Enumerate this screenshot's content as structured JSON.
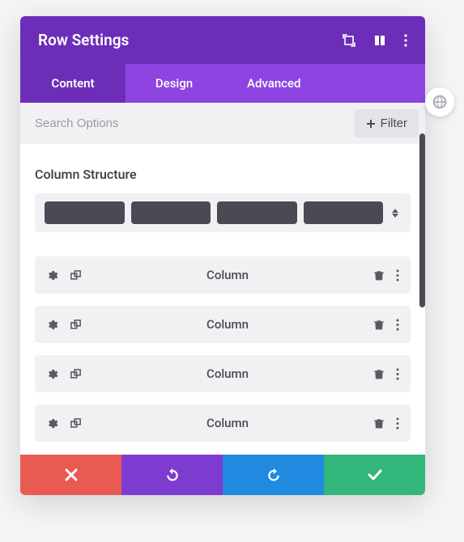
{
  "header": {
    "title": "Row Settings"
  },
  "tabs": [
    {
      "label": "Content",
      "active": true
    },
    {
      "label": "Design",
      "active": false
    },
    {
      "label": "Advanced",
      "active": false
    }
  ],
  "search": {
    "placeholder": "Search Options"
  },
  "filter": {
    "label": "Filter"
  },
  "section": {
    "title": "Column Structure"
  },
  "columns": [
    {
      "label": "Column"
    },
    {
      "label": "Column"
    },
    {
      "label": "Column"
    },
    {
      "label": "Column"
    }
  ],
  "colors": {
    "primary": "#6c2eb9",
    "primary_light": "#8e44e0",
    "danger": "#e85a52",
    "info": "#1f8ae0",
    "success": "#33b679"
  }
}
